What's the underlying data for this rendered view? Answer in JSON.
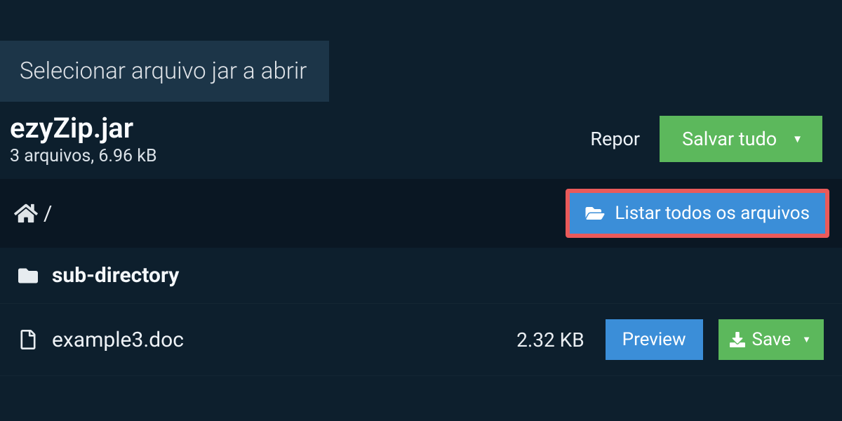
{
  "tab": {
    "label": "Selecionar arquivo jar a abrir"
  },
  "file": {
    "name": "ezyZip.jar",
    "meta": "3 arquivos, 6.96 kB"
  },
  "actions": {
    "reset": "Repor",
    "save_all": "Salvar tudo"
  },
  "breadcrumb": {
    "separator": "/",
    "list_all": "Listar todos os arquivos"
  },
  "rows": [
    {
      "type": "dir",
      "name": "sub-directory"
    },
    {
      "type": "file",
      "name": "example3.doc",
      "size": "2.32 KB"
    }
  ],
  "row_actions": {
    "preview": "Preview",
    "save": "Save"
  }
}
